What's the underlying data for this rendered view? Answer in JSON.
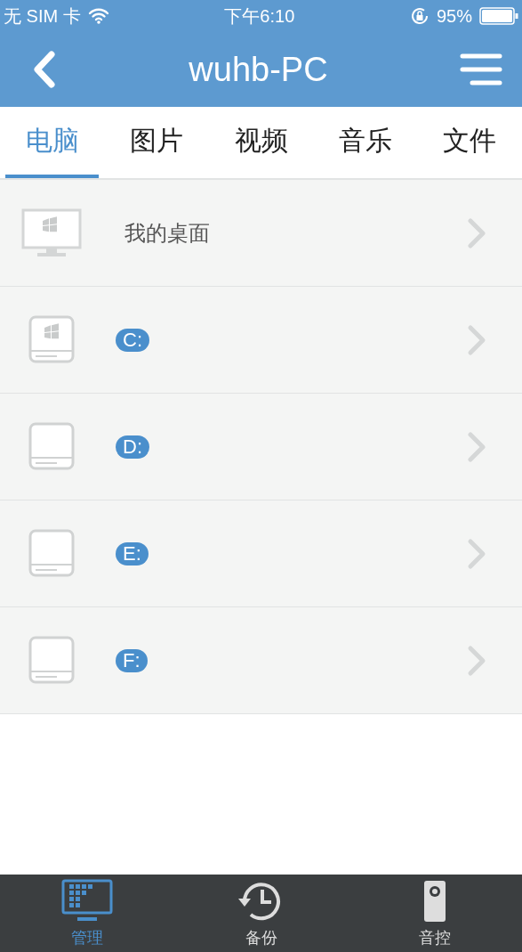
{
  "status_bar": {
    "carrier": "无 SIM 卡",
    "time": "下午6:10",
    "battery": "95%"
  },
  "nav": {
    "title": "wuhb-PC"
  },
  "tabs": [
    {
      "label": "电脑",
      "selected": true
    },
    {
      "label": "图片",
      "selected": false
    },
    {
      "label": "视频",
      "selected": false
    },
    {
      "label": "音乐",
      "selected": false
    },
    {
      "label": "文件",
      "selected": false
    }
  ],
  "items": [
    {
      "kind": "desktop",
      "label": "我的桌面"
    },
    {
      "kind": "system-drive",
      "label": "C:"
    },
    {
      "kind": "drive",
      "label": "D:"
    },
    {
      "kind": "drive",
      "label": "E:"
    },
    {
      "kind": "drive",
      "label": "F:"
    }
  ],
  "bottom_tabs": [
    {
      "kind": "manage",
      "label": "管理",
      "selected": true
    },
    {
      "kind": "backup",
      "label": "备份",
      "selected": false
    },
    {
      "kind": "remote",
      "label": "音控",
      "selected": false
    }
  ]
}
